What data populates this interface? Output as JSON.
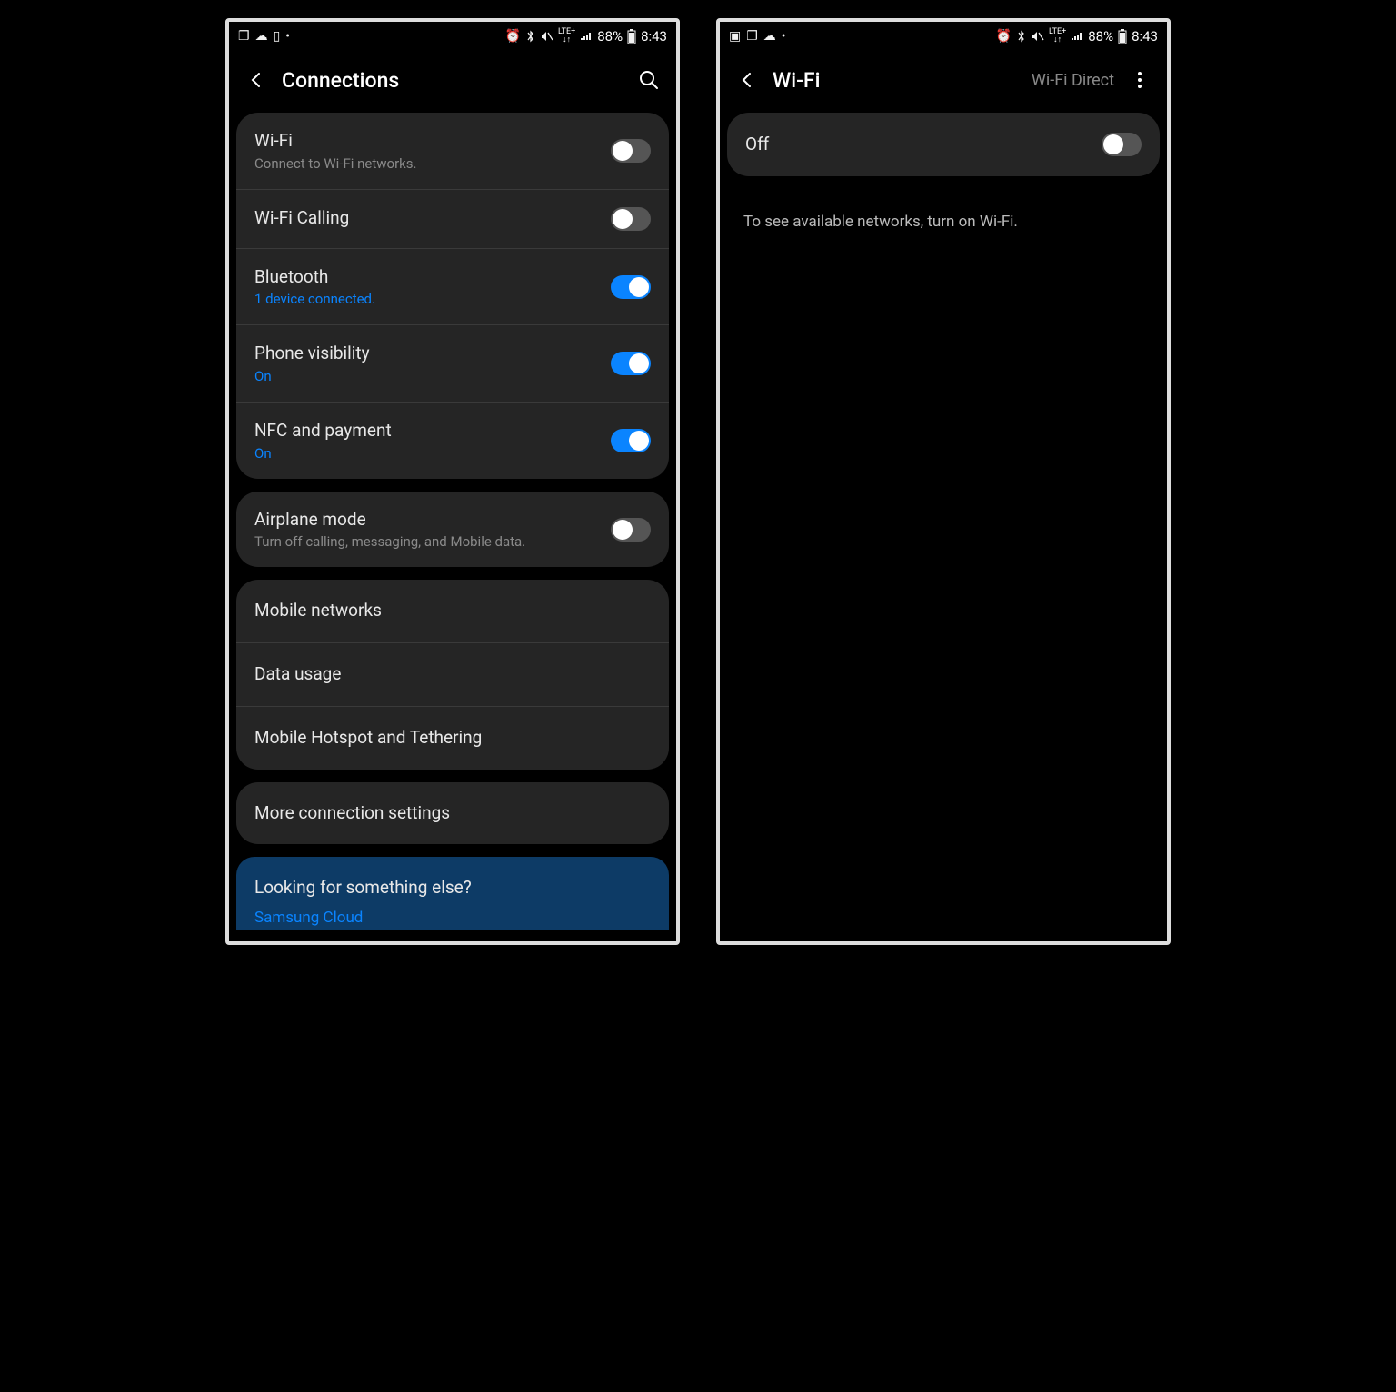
{
  "status": {
    "time": "8:43",
    "battery": "88%",
    "lte_top": "LTE+",
    "lte_bottom": "↓↑"
  },
  "left": {
    "title": "Connections",
    "groups": [
      {
        "rows": [
          {
            "title": "Wi-Fi",
            "sub": "Connect to Wi-Fi networks.",
            "sub_accent": false,
            "toggle": "off"
          },
          {
            "title": "Wi-Fi Calling",
            "sub": "",
            "sub_accent": false,
            "toggle": "off"
          },
          {
            "title": "Bluetooth",
            "sub": "1 device connected.",
            "sub_accent": true,
            "toggle": "on"
          },
          {
            "title": "Phone visibility",
            "sub": "On",
            "sub_accent": true,
            "toggle": "on"
          },
          {
            "title": "NFC and payment",
            "sub": "On",
            "sub_accent": true,
            "toggle": "on"
          }
        ]
      },
      {
        "rows": [
          {
            "title": "Airplane mode",
            "sub": "Turn off calling, messaging, and Mobile data.",
            "sub_accent": false,
            "toggle": "off"
          }
        ]
      },
      {
        "rows": [
          {
            "title": "Mobile networks",
            "sub": "",
            "sub_accent": false,
            "toggle": null
          },
          {
            "title": "Data usage",
            "sub": "",
            "sub_accent": false,
            "toggle": null
          },
          {
            "title": "Mobile Hotspot and Tethering",
            "sub": "",
            "sub_accent": false,
            "toggle": null
          }
        ]
      },
      {
        "rows": [
          {
            "title": "More connection settings",
            "sub": "",
            "sub_accent": false,
            "toggle": null
          }
        ]
      }
    ],
    "help": {
      "title": "Looking for something else?",
      "link": "Samsung Cloud"
    }
  },
  "right": {
    "title": "Wi-Fi",
    "action": "Wi-Fi Direct",
    "switch_label": "Off",
    "switch_state": "off",
    "message": "To see available networks, turn on Wi-Fi."
  }
}
